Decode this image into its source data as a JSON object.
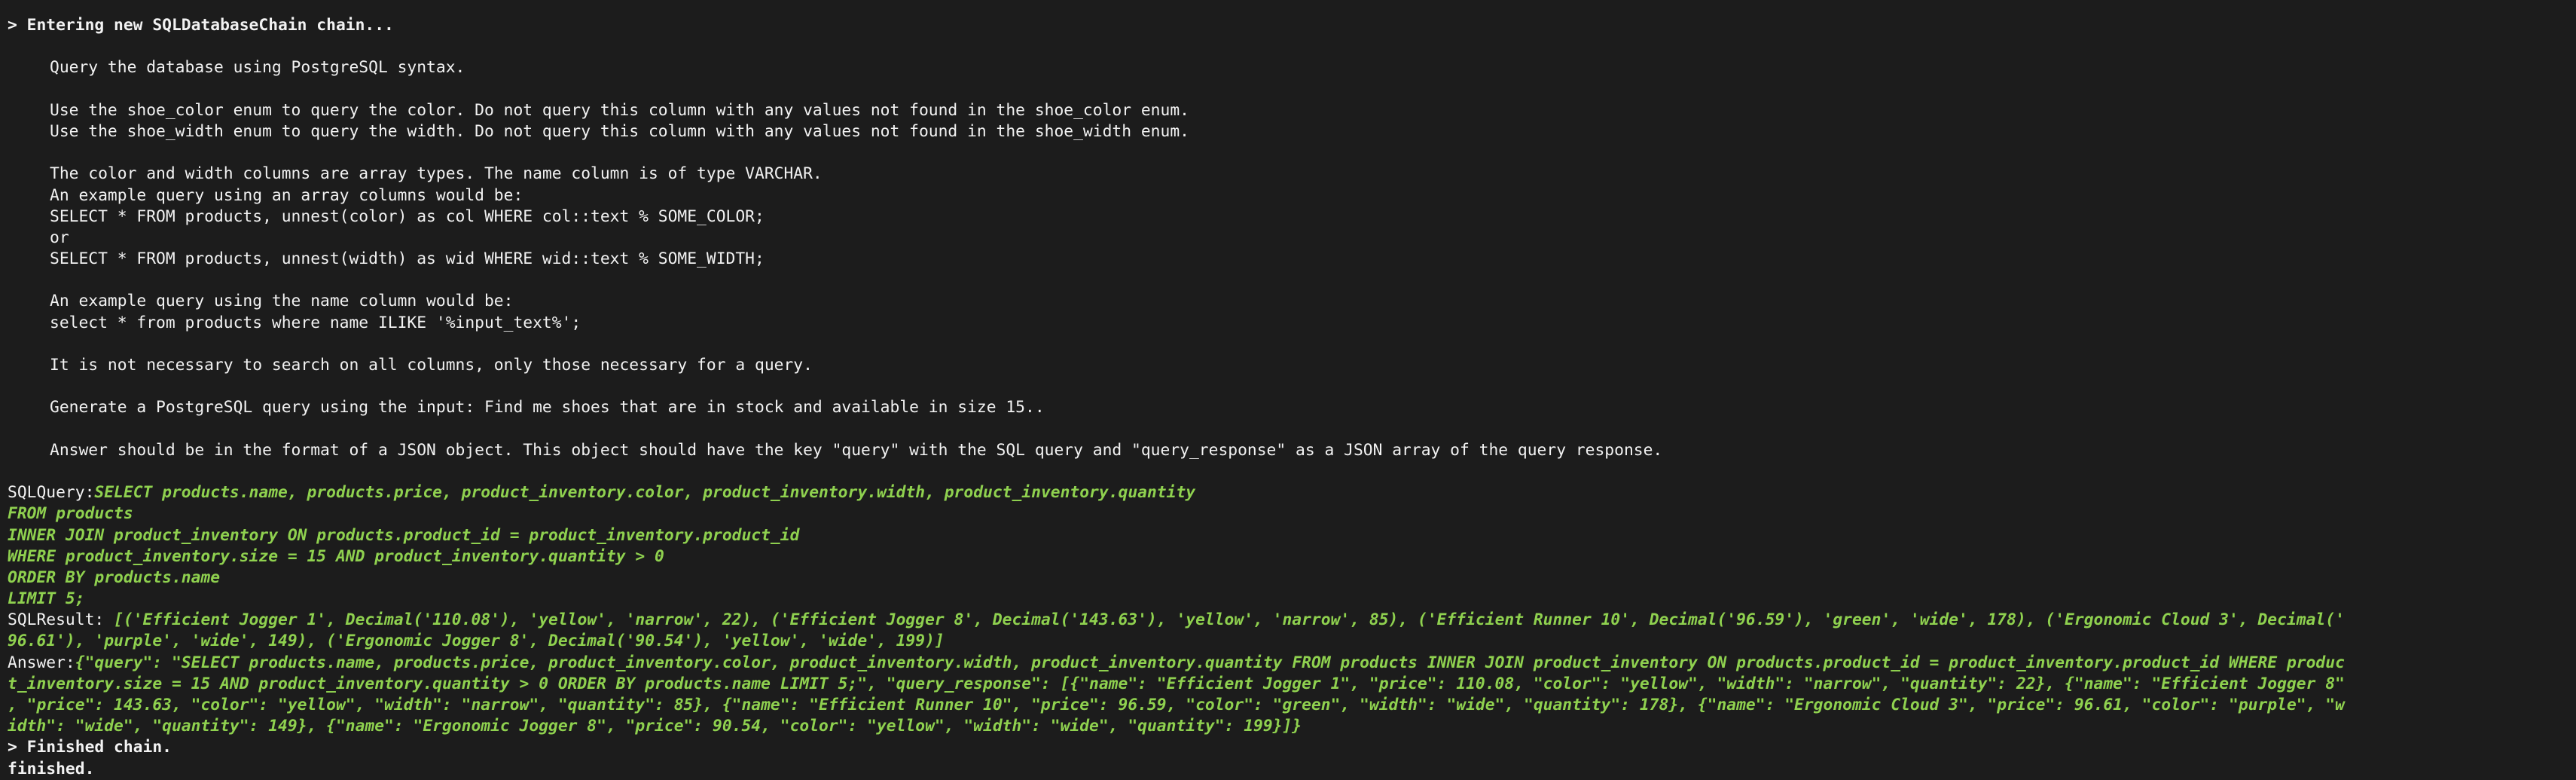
{
  "header": {
    "entering": "> Entering new SQLDatabaseChain chain..."
  },
  "prompt": {
    "lines": [
      "Query the database using PostgreSQL syntax.",
      "",
      "Use the shoe_color enum to query the color. Do not query this column with any values not found in the shoe_color enum.",
      "Use the shoe_width enum to query the width. Do not query this column with any values not found in the shoe_width enum.",
      "",
      "The color and width columns are array types. The name column is of type VARCHAR.",
      "An example query using an array columns would be:",
      "SELECT * FROM products, unnest(color) as col WHERE col::text % SOME_COLOR;",
      "or",
      "SELECT * FROM products, unnest(width) as wid WHERE wid::text % SOME_WIDTH;",
      "",
      "An example query using the name column would be:",
      "select * from products where name ILIKE '%input_text%';",
      "",
      "It is not necessary to search on all columns, only those necessary for a query.",
      "",
      "Generate a PostgreSQL query using the input: Find me shoes that are in stock and available in size 15..",
      "",
      "Answer should be in the format of a JSON object. This object should have the key \"query\" with the SQL query and \"query_response\" as a JSON array of the query response."
    ]
  },
  "sql_query": {
    "label": "SQLQuery:",
    "first": "SELECT products.name, products.price, product_inventory.color, product_inventory.width, product_inventory.quantity",
    "rest": [
      "FROM products",
      "INNER JOIN product_inventory ON products.product_id = product_inventory.product_id",
      "WHERE product_inventory.size = 15 AND product_inventory.quantity > 0",
      "ORDER BY products.name",
      "LIMIT 5;"
    ]
  },
  "sql_result": {
    "label": "SQLResult: ",
    "first": "[('Efficient Jogger 1', Decimal('110.08'), 'yellow', 'narrow', 22), ('Efficient Jogger 8', Decimal('143.63'), 'yellow', 'narrow', 85), ('Efficient Runner 10', Decimal('96.59'), 'green', 'wide', 178), ('Ergonomic Cloud 3', Decimal('",
    "rest": [
      "96.61'), 'purple', 'wide', 149), ('Ergonomic Jogger 8', Decimal('90.54'), 'yellow', 'wide', 199)]"
    ]
  },
  "answer": {
    "label": "Answer:",
    "first": "{\"query\": \"SELECT products.name, products.price, product_inventory.color, product_inventory.width, product_inventory.quantity FROM products INNER JOIN product_inventory ON products.product_id = product_inventory.product_id WHERE produc",
    "rest": [
      "t_inventory.size = 15 AND product_inventory.quantity > 0 ORDER BY products.name LIMIT 5;\", \"query_response\": [{\"name\": \"Efficient Jogger 1\", \"price\": 110.08, \"color\": \"yellow\", \"width\": \"narrow\", \"quantity\": 22}, {\"name\": \"Efficient Jogger 8\"",
      ", \"price\": 143.63, \"color\": \"yellow\", \"width\": \"narrow\", \"quantity\": 85}, {\"name\": \"Efficient Runner 10\", \"price\": 96.59, \"color\": \"green\", \"width\": \"wide\", \"quantity\": 178}, {\"name\": \"Ergonomic Cloud 3\", \"price\": 96.61, \"color\": \"purple\", \"w",
      "idth\": \"wide\", \"quantity\": 149}, {\"name\": \"Ergonomic Jogger 8\", \"price\": 90.54, \"color\": \"yellow\", \"width\": \"wide\", \"quantity\": 199}]}"
    ]
  },
  "footer": {
    "finished_chain": "> Finished chain.",
    "finished": "finished."
  },
  "colors": {
    "background": "#1c1c1c",
    "text": "#f2f2f2",
    "accent_green": "#8fd14f"
  }
}
